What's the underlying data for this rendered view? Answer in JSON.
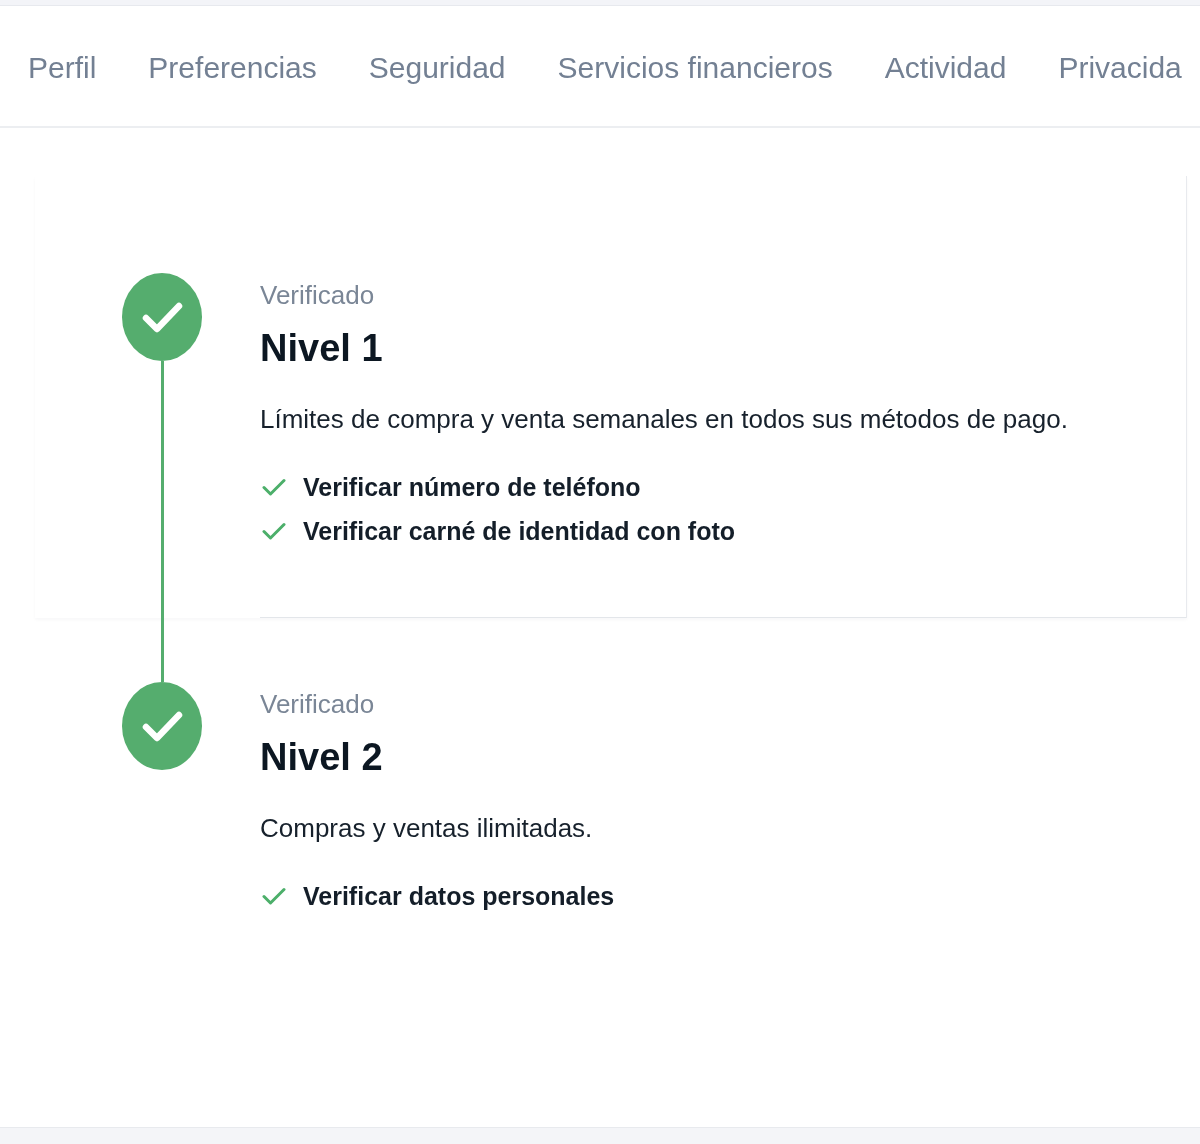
{
  "tabs": [
    {
      "label": "Perfil",
      "selected": false
    },
    {
      "label": "Preferencias",
      "selected": false
    },
    {
      "label": "Seguridad",
      "selected": false
    },
    {
      "label": "Servicios financieros",
      "selected": false
    },
    {
      "label": "Actividad",
      "selected": false
    },
    {
      "label": "Privacida",
      "selected": false
    }
  ],
  "levels": [
    {
      "selected": true,
      "verified": true,
      "status": "Verificado",
      "title": "Nivel 1",
      "description": "Límites de compra y venta semanales en todos sus métodos de pago.",
      "requirements": [
        {
          "label": "Verificar número de teléfono",
          "done": true
        },
        {
          "label": "Verificar carné de identidad con foto",
          "done": true
        }
      ]
    },
    {
      "selected": false,
      "verified": true,
      "status": "Verificado",
      "title": "Nivel 2",
      "description": "Compras y ventas ilimitadas.",
      "requirements": [
        {
          "label": "Verificar datos personales",
          "done": true
        }
      ]
    }
  ]
}
